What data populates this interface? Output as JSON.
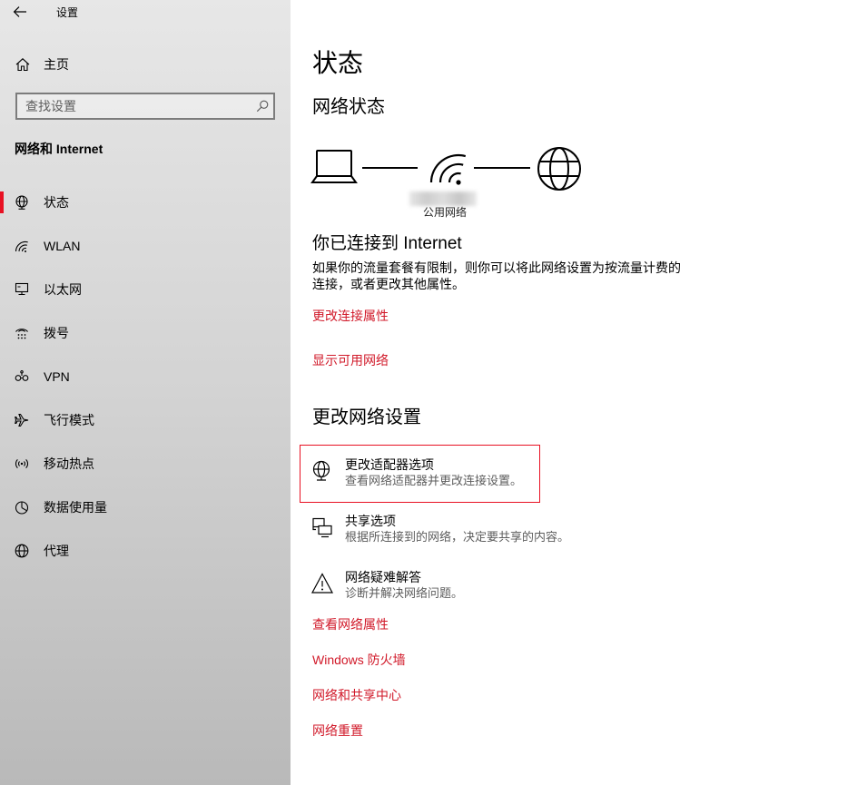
{
  "window": {
    "title": "设置"
  },
  "colors": {
    "accent": "#e81123",
    "link": "#d11a2a",
    "secondary_text": "#5d5d5d",
    "sidebar_top": "#e7e7e7",
    "sidebar_bottom": "#b9b9b9"
  },
  "sidebar": {
    "back_icon": "back-arrow-icon",
    "home": {
      "label": "主页",
      "icon": "home-icon"
    },
    "search": {
      "placeholder": "查找设置",
      "icon": "search-icon"
    },
    "section_title": "网络和 Internet",
    "items": [
      {
        "label": "状态",
        "icon": "network-status-icon",
        "active": true
      },
      {
        "label": "WLAN",
        "icon": "wifi-icon",
        "active": false
      },
      {
        "label": "以太网",
        "icon": "ethernet-icon",
        "active": false
      },
      {
        "label": "拨号",
        "icon": "dialup-icon",
        "active": false
      },
      {
        "label": "VPN",
        "icon": "vpn-icon",
        "active": false
      },
      {
        "label": "飞行模式",
        "icon": "airplane-icon",
        "active": false
      },
      {
        "label": "移动热点",
        "icon": "mobile-hotspot-icon",
        "active": false
      },
      {
        "label": "数据使用量",
        "icon": "data-usage-icon",
        "active": false
      },
      {
        "label": "代理",
        "icon": "proxy-globe-icon",
        "active": false
      }
    ]
  },
  "main": {
    "page_title": "状态",
    "network_status": {
      "heading": "网络状态",
      "diagram_icons": [
        "laptop-icon",
        "wifi-signal-icon",
        "internet-globe-icon"
      ],
      "network_type": "公用网络"
    },
    "connection": {
      "heading": "你已连接到 Internet",
      "description_lines": [
        "如果你的流量套餐有限制，则你可以将此网络设置为按流量计费的",
        "连接，或者更改其他属性。"
      ],
      "links": [
        {
          "label": "更改连接属性"
        },
        {
          "label": "显示可用网络"
        }
      ]
    },
    "change_settings": {
      "heading": "更改网络设置",
      "items": [
        {
          "title": "更改适配器选项",
          "subtitle": "查看网络适配器并更改连接设置。",
          "icon": "adapter-options-icon",
          "focused": true
        },
        {
          "title": "共享选项",
          "subtitle": "根据所连接到的网络，决定要共享的内容。",
          "icon": "sharing-options-icon",
          "focused": false
        },
        {
          "title": "网络疑难解答",
          "subtitle": "诊断并解决网络问题。",
          "icon": "warning-icon",
          "focused": false
        }
      ],
      "links": [
        {
          "label": "查看网络属性"
        },
        {
          "label": "Windows 防火墙"
        },
        {
          "label": "网络和共享中心"
        },
        {
          "label": "网络重置"
        }
      ]
    }
  }
}
